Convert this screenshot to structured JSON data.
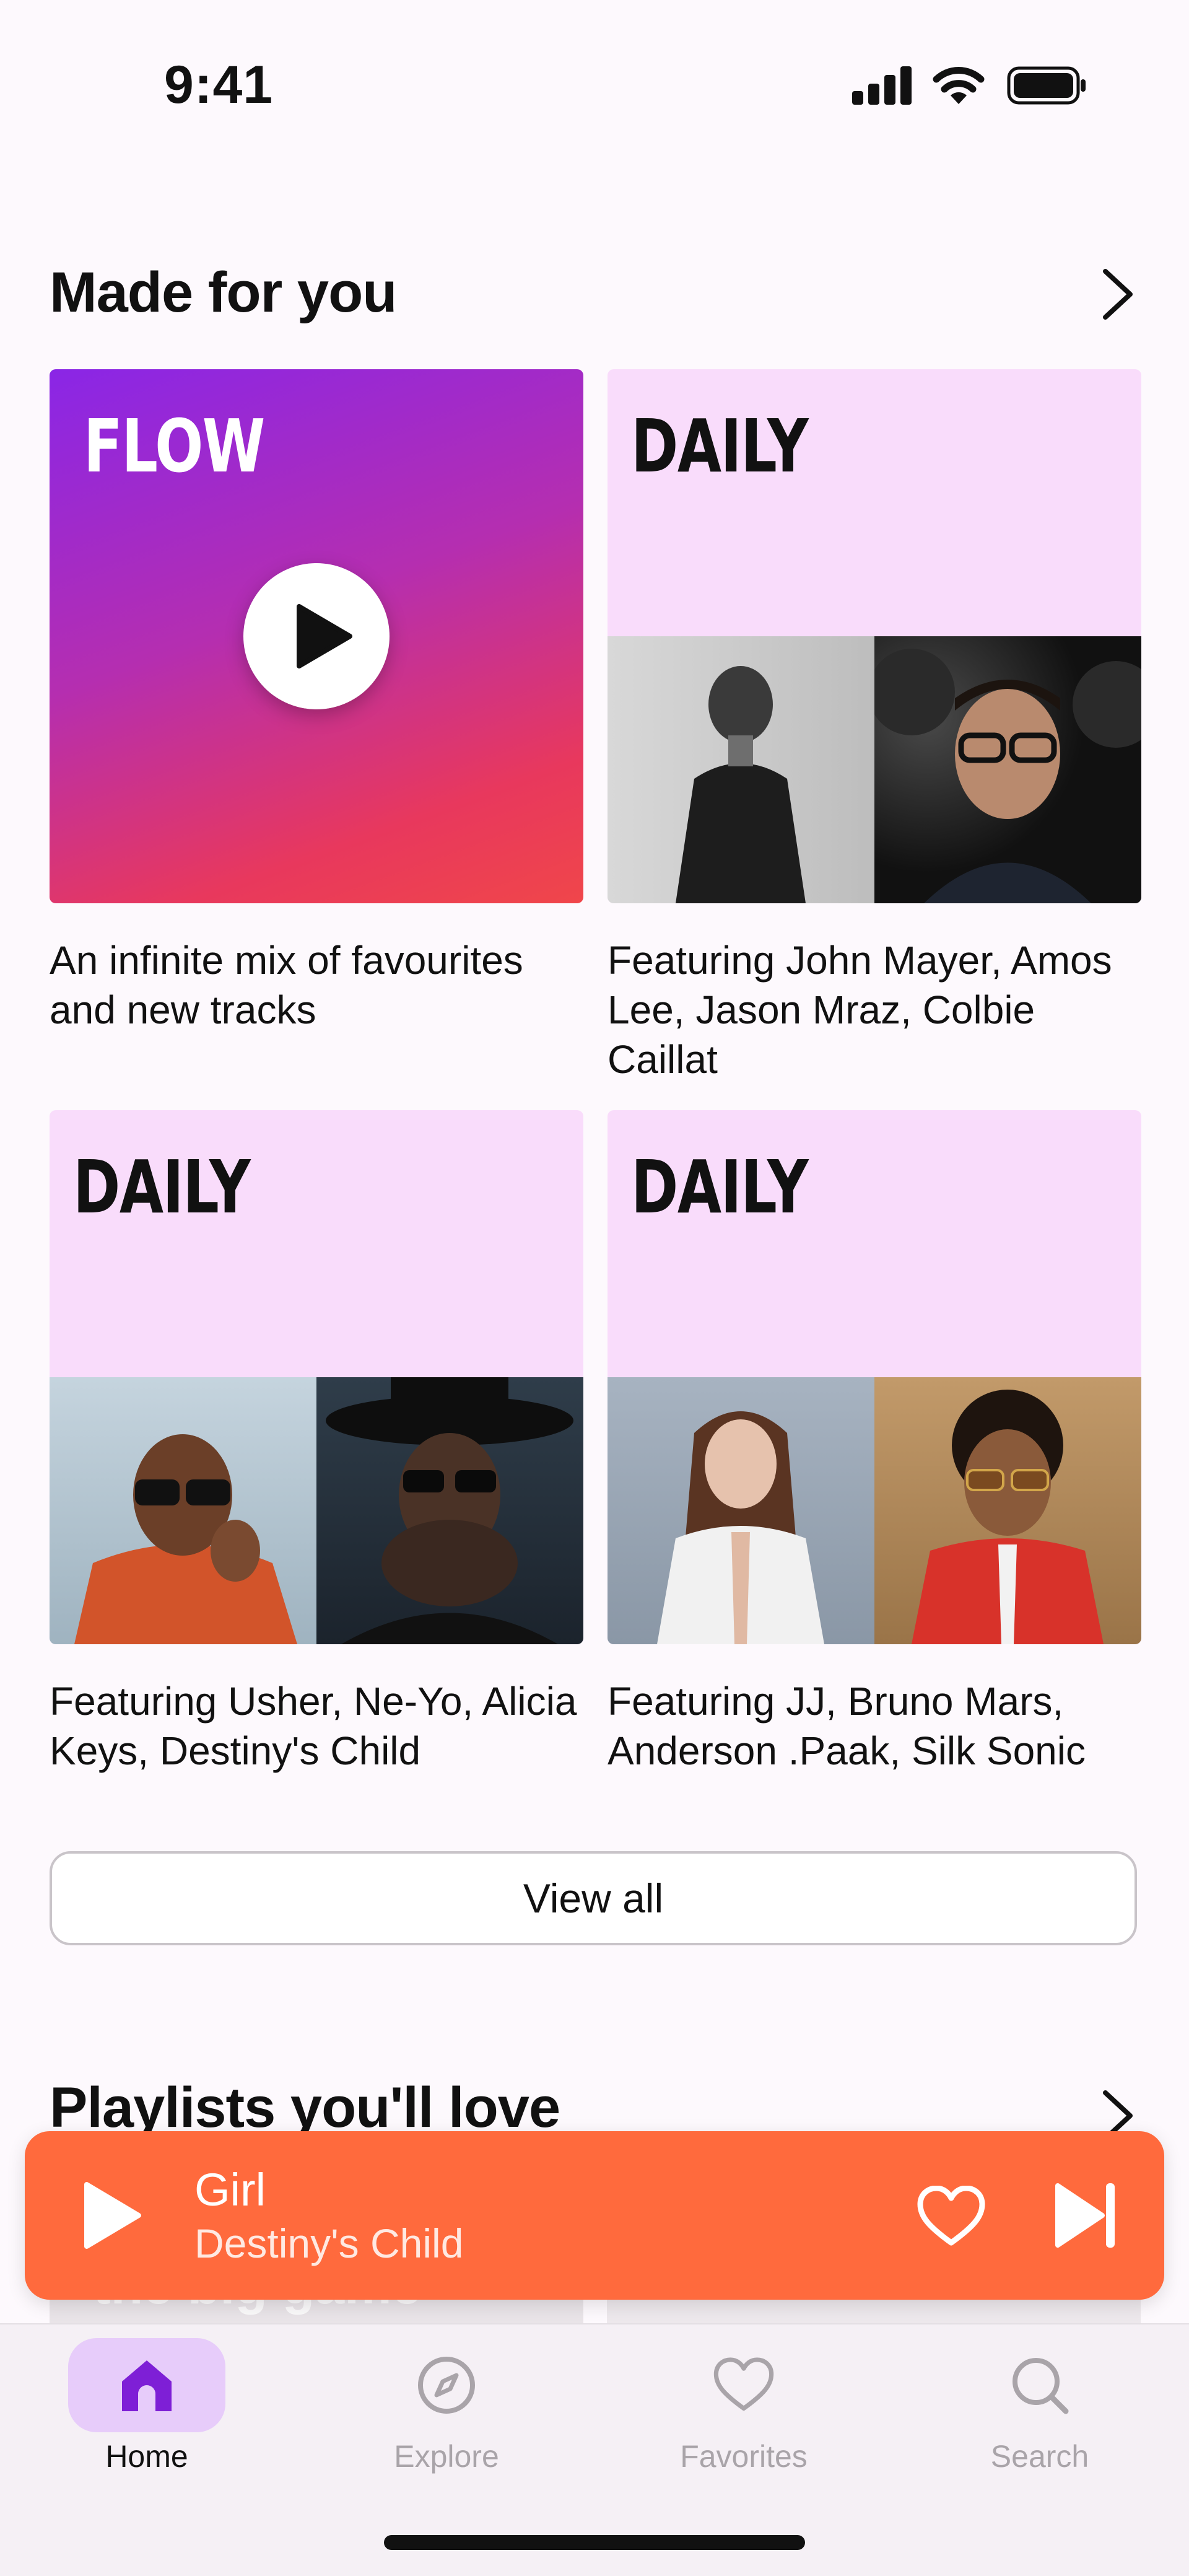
{
  "status_bar": {
    "time": "9:41"
  },
  "made_for_you": {
    "title": "Made for you",
    "cards": [
      {
        "label": "FLOW",
        "caption": "An infinite mix of favourites and new tracks"
      },
      {
        "label": "DAILY",
        "caption": "Featuring John Mayer, Amos Lee, Jason Mraz, Colbie Caillat"
      },
      {
        "label": "DAILY",
        "caption": "Featuring Usher, Ne-Yo, Alicia Keys, Destiny's Child"
      },
      {
        "label": "DAILY",
        "caption": "Featuring JJ, Bruno Mars, Anderson .Paak, Silk Sonic"
      }
    ],
    "view_all": "View all"
  },
  "playlists": {
    "title": "Playlists you'll love",
    "peek_text": "the big game"
  },
  "now_playing": {
    "title": "Girl",
    "artist": "Destiny's Child"
  },
  "tabs": [
    {
      "label": "Home",
      "icon": "home-icon",
      "active": true
    },
    {
      "label": "Explore",
      "icon": "compass-icon",
      "active": false
    },
    {
      "label": "Favorites",
      "icon": "heart-icon",
      "active": false
    },
    {
      "label": "Search",
      "icon": "search-icon",
      "active": false
    }
  ],
  "colors": {
    "accent": "#8a26e6",
    "mini_player": "#ff6a3d",
    "daily_bg": "#f9dcfb"
  }
}
